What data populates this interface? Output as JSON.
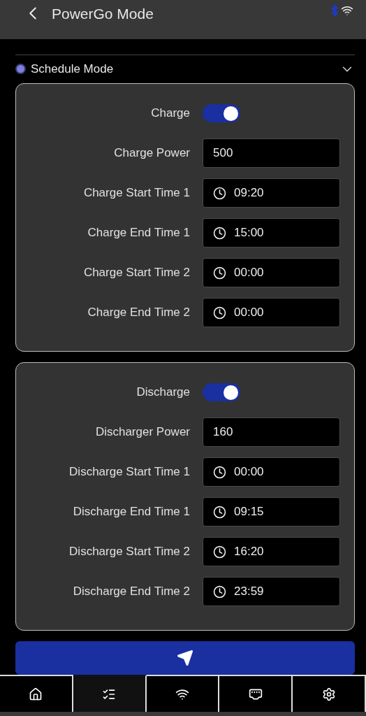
{
  "header": {
    "title": "PowerGo Mode"
  },
  "mode": {
    "label": "Schedule Mode",
    "selected": true,
    "expanded": true
  },
  "groups": [
    {
      "toggle": {
        "label": "Charge",
        "on": true
      },
      "fields": [
        {
          "kind": "number",
          "label": "Charge Power",
          "value": "500"
        },
        {
          "kind": "time",
          "label": "Charge Start Time 1",
          "value": "09:20"
        },
        {
          "kind": "time",
          "label": "Charge End Time 1",
          "value": "15:00"
        },
        {
          "kind": "time",
          "label": "Charge Start Time 2",
          "value": "00:00"
        },
        {
          "kind": "time",
          "label": "Charge End Time 2",
          "value": "00:00"
        }
      ]
    },
    {
      "toggle": {
        "label": "Discharge",
        "on": true
      },
      "fields": [
        {
          "kind": "number",
          "label": "Discharger Power",
          "value": "160"
        },
        {
          "kind": "time",
          "label": "Discharge Start Time 1",
          "value": "00:00"
        },
        {
          "kind": "time",
          "label": "Discharge End Time 1",
          "value": "09:15"
        },
        {
          "kind": "time",
          "label": "Discharge Start Time 2",
          "value": "16:20"
        },
        {
          "kind": "time",
          "label": "Discharge End Time 2",
          "value": "23:59"
        }
      ]
    }
  ],
  "tabs": [
    {
      "kind": "home",
      "selected": false
    },
    {
      "kind": "checklist",
      "selected": true
    },
    {
      "kind": "wifi",
      "selected": false
    },
    {
      "kind": "ethernet",
      "selected": false
    },
    {
      "kind": "settings",
      "selected": false
    }
  ]
}
